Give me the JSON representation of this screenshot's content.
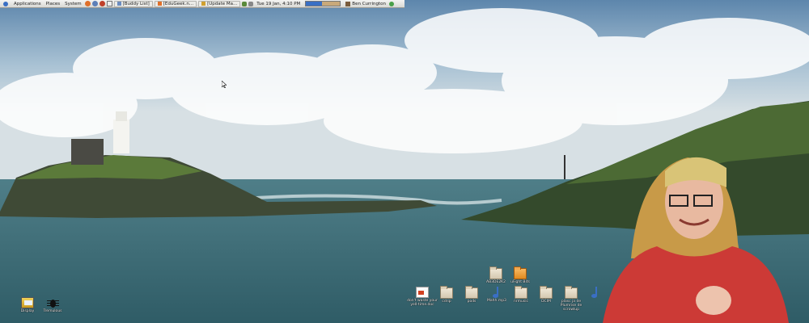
{
  "top_panel": {
    "menus": [
      "Applications",
      "Places",
      "System"
    ],
    "tasks": [
      "[Buddy List]",
      "[EduGeek.n...",
      "[Update Ma..."
    ],
    "clock": "Tue 19 Jan,  4:10 PM",
    "user": "Ben Currington"
  },
  "desktop": {
    "left_icons": [
      {
        "label": "Display",
        "icon": "display-icon"
      },
      {
        "label": "Tremulous",
        "icon": "bug-icon"
      }
    ],
    "top_row": [
      {
        "label": "AB3DE2K2",
        "icon": "folder-icon"
      },
      {
        "label": "uFight Bits",
        "icon": "orange-folder-icon"
      }
    ],
    "bottom_row": [
      {
        "label": "don't waste your yell-time.doc",
        "icon": "document-icon"
      },
      {
        "label": "cdrip",
        "icon": "folder-icon"
      },
      {
        "label": "pods",
        "icon": "folder-icon"
      },
      {
        "label": "Mahh.mp3",
        "icon": "music-icon"
      },
      {
        "label": "nrmusic",
        "icon": "folder-icon"
      },
      {
        "label": "DCIM",
        "icon": "folder-icon"
      },
      {
        "label": "plasc ja de Plumrise de scrowlup",
        "icon": "folder-icon"
      },
      {
        "label": "",
        "icon": "music-icon"
      }
    ]
  },
  "colors": {
    "sky_top": "#5d86ac",
    "sea": "#3f6f78",
    "panel_bg": "#e6e6e2"
  }
}
